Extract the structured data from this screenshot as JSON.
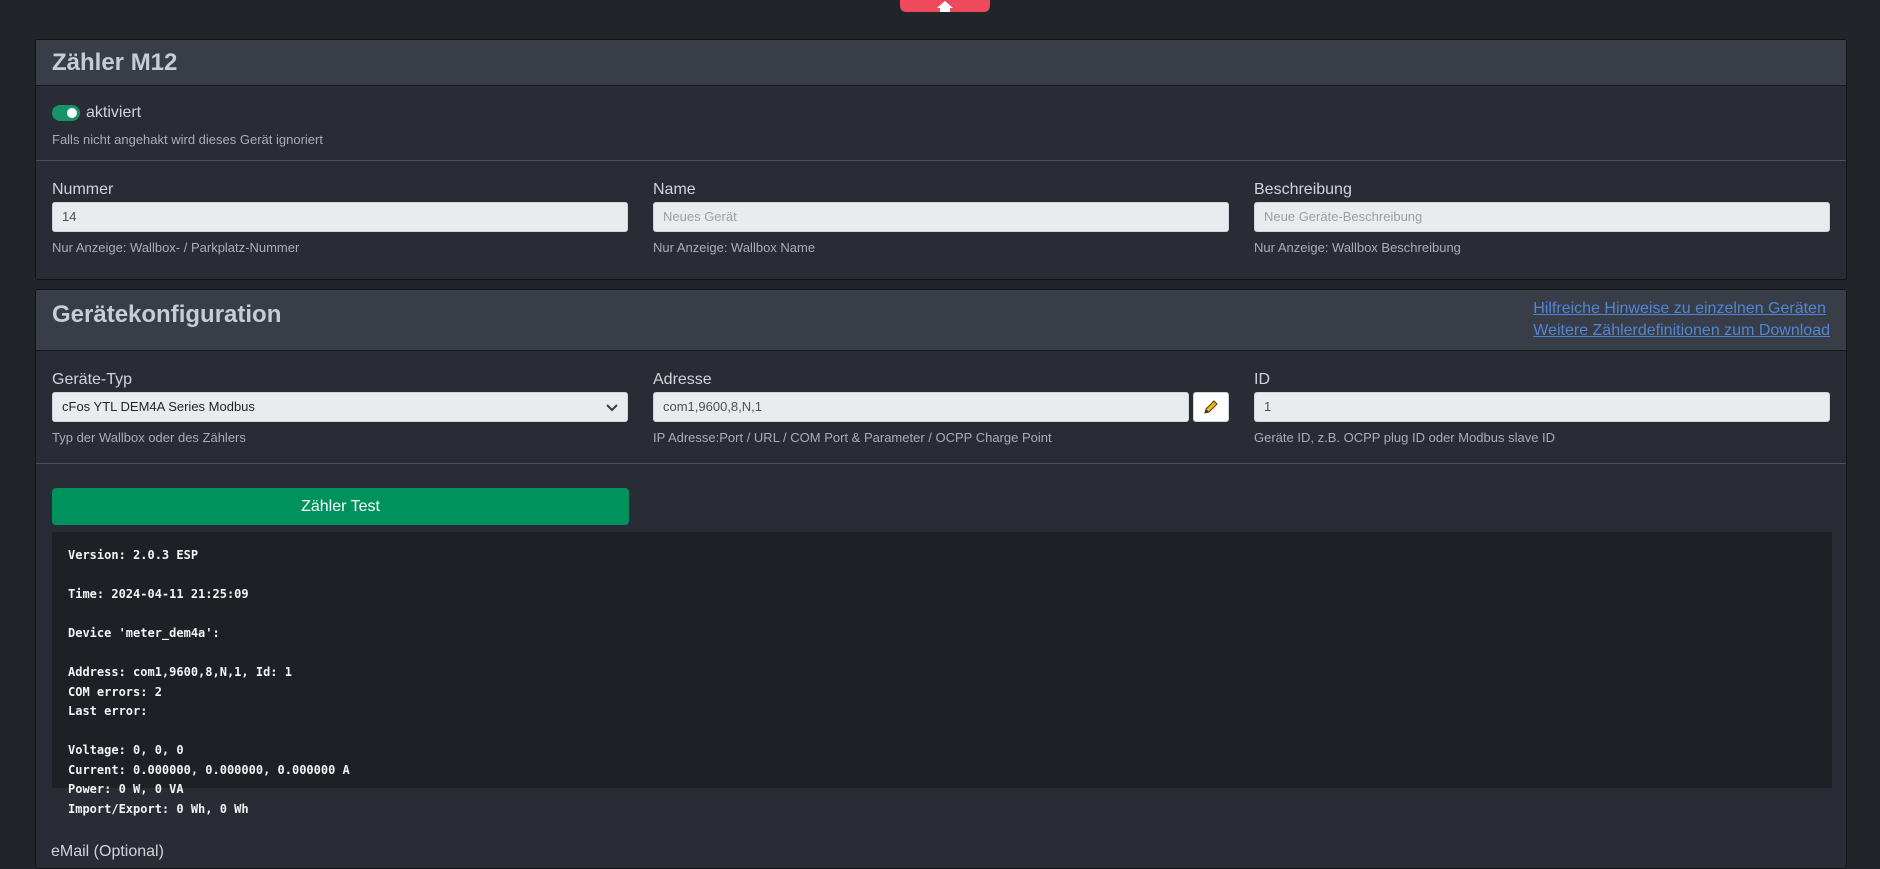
{
  "card1": {
    "title": "Zähler M12",
    "toggle_label": "aktiviert",
    "toggle_help": "Falls nicht angehakt wird dieses Gerät ignoriert",
    "fields": [
      {
        "label": "Nummer",
        "value": "14",
        "placeholder": "",
        "help": "Nur Anzeige: Wallbox- / Parkplatz-Nummer"
      },
      {
        "label": "Name",
        "value": "",
        "placeholder": "Neues Gerät",
        "help": "Nur Anzeige: Wallbox Name"
      },
      {
        "label": "Beschreibung",
        "value": "",
        "placeholder": "Neue Geräte-Beschreibung",
        "help": "Nur Anzeige: Wallbox Beschreibung"
      }
    ]
  },
  "card2": {
    "title": "Gerätekonfiguration",
    "links": [
      "Hilfreiche Hinweise zu einzelnen Geräten",
      "Weitere Zählerdefinitionen zum Download"
    ],
    "device_type": {
      "label": "Geräte-Typ",
      "value": "cFos YTL DEM4A Series Modbus",
      "help": "Typ der Wallbox oder des Zählers"
    },
    "address": {
      "label": "Adresse",
      "value": "com1,9600,8,N,1",
      "help": "IP Adresse:Port / URL / COM Port & Parameter / OCPP Charge Point"
    },
    "id": {
      "label": "ID",
      "value": "1",
      "help": "Geräte ID, z.B. OCPP plug ID oder Modbus slave ID"
    },
    "test_button": "Zähler Test",
    "console_lines": [
      "Version: 2.0.3 ESP",
      "",
      "Time: 2024-04-11 21:25:09",
      "",
      "Device 'meter_dem4a':",
      "",
      "Address: com1,9600,8,N,1, Id: 1",
      "COM errors: 2",
      "Last error:",
      "",
      "Voltage: 0, 0, 0",
      "Current: 0.000000, 0.000000, 0.000000 A",
      "Power: 0 W, 0 VA",
      "Import/Export: 0 Wh, 0 Wh"
    ],
    "email_label": "eMail (Optional)"
  },
  "colors": {
    "accent_green": "#00925d",
    "top_tab_red": "#ef4a5c",
    "link_blue": "#4f86d6"
  },
  "icons": {
    "top_tab": "home-icon",
    "address_button": "pencil-icon",
    "select": "chevron-down-icon"
  }
}
